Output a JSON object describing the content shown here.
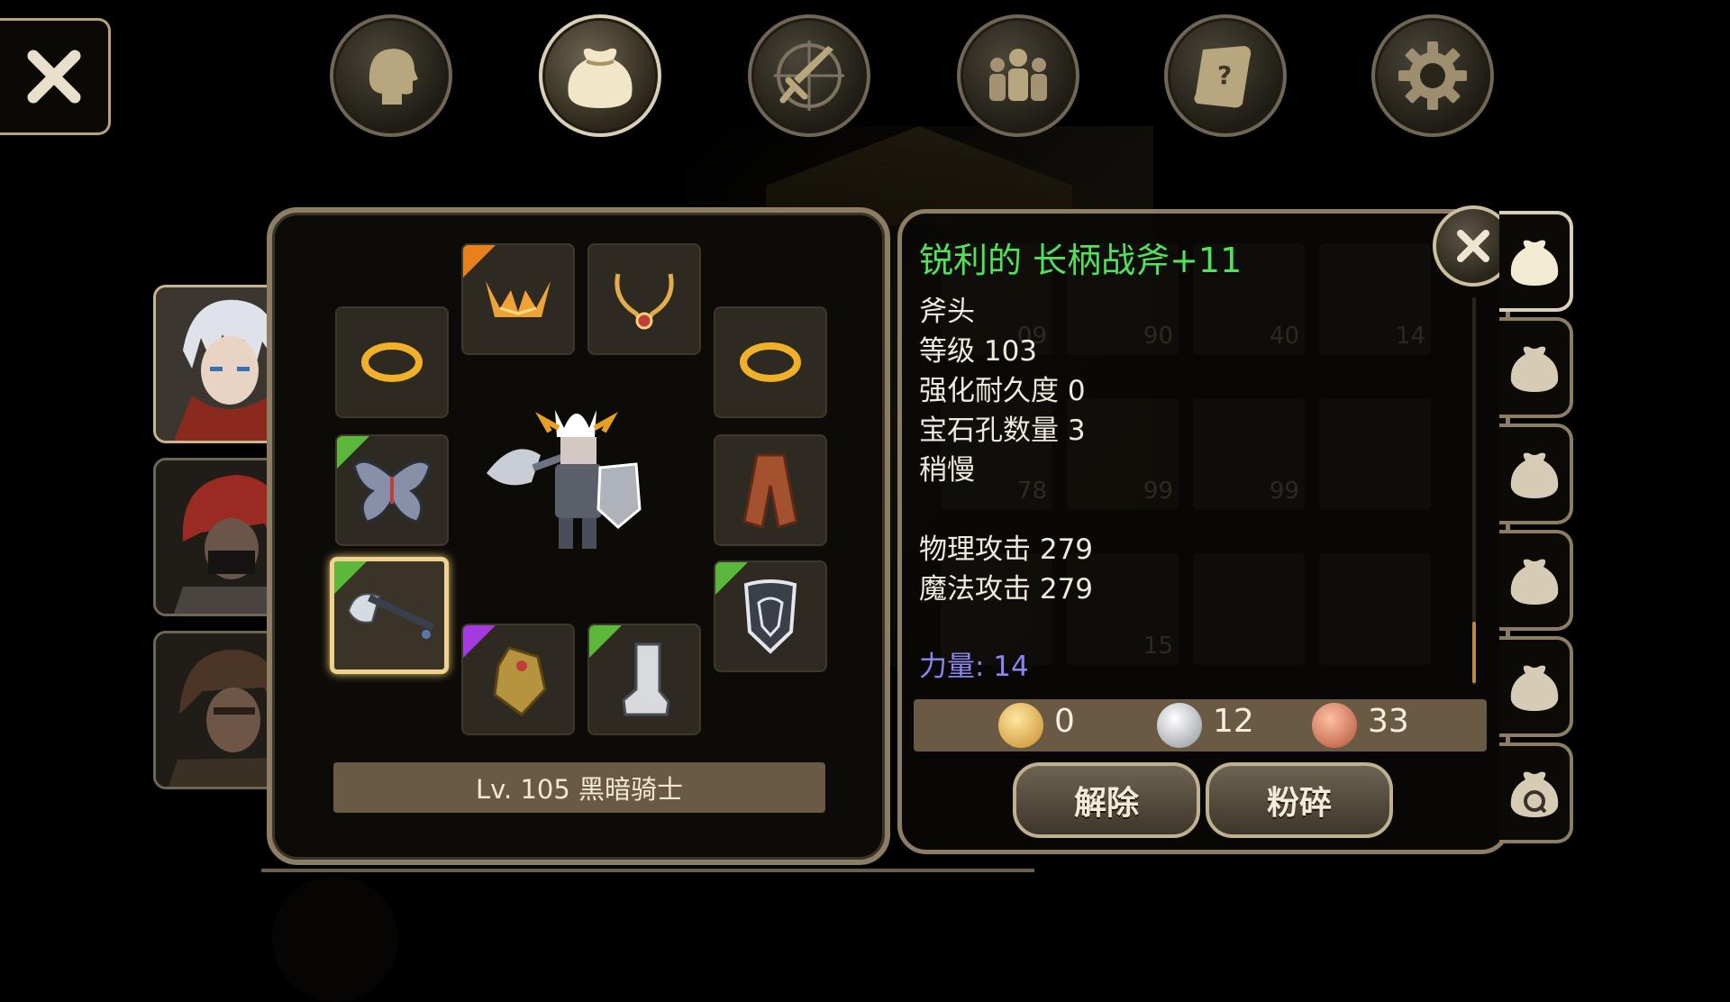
{
  "item": {
    "name": "锐利的 长柄战斧+11",
    "type": "斧头",
    "level": "等级 103",
    "durability": "强化耐久度 0",
    "gem_slots": "宝石孔数量 3",
    "speed": "稍慢",
    "phys_attack": "物理攻击 279",
    "magic_attack": "魔法攻击 279",
    "strength": "力量: 14"
  },
  "currency": {
    "gold": "0",
    "silver": "12",
    "copper": "33"
  },
  "buttons": {
    "unequip": "解除",
    "smash": "粉碎"
  },
  "character": {
    "level_label": "Lv. 105 黑暗骑士"
  },
  "inventory_counts": [
    "09",
    "90",
    "40",
    "14",
    "78",
    "99",
    "99",
    "",
    "",
    "",
    "",
    "",
    "15",
    "",
    "",
    ""
  ],
  "colors": {
    "item_name": "#52e15a",
    "stat_blue": "#8c87f0",
    "frame": "#8c7d64",
    "selected_slot": "#f0d28e",
    "rarity_orange": "#e8801c",
    "rarity_green": "#5bb83a",
    "rarity_purple": "#a43be0"
  },
  "icons": {
    "nav": [
      "head-icon",
      "bag-icon",
      "sword-compass-icon",
      "party-icon",
      "quest-scroll-icon",
      "gear-icon"
    ],
    "equip": [
      "crown-icon",
      "necklace-icon",
      "ring-icon",
      "ring-icon",
      "wings-icon",
      "cape-icon",
      "axe-icon",
      "shield-icon",
      "gauntlet-icon",
      "boots-icon"
    ]
  }
}
